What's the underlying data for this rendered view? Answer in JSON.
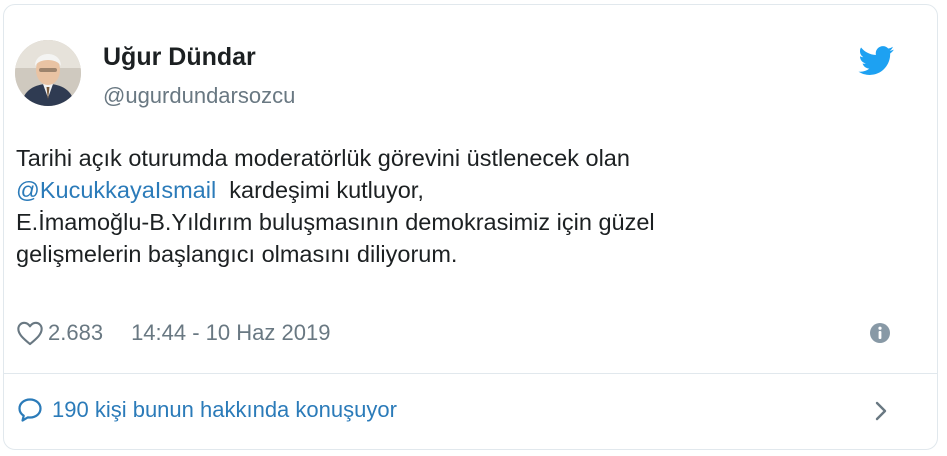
{
  "author": {
    "name": "Uğur Dündar",
    "handle": "@ugurdundarsozcu"
  },
  "tweet": {
    "text_line1": "Tarihi açık oturumda moderatörlük görevini üstlenecek olan",
    "mention": "@KucukkayaIsmail",
    "text_line2_rest": "  kardeşimi kutluyor,",
    "text_line3": "E.İmamoğlu-B.Yıldırım buluşmasının demokrasimiz için güzel",
    "text_line4": "gelişmelerin başlangıcı olmasını diliyorum."
  },
  "meta": {
    "likes": "2.683",
    "timestamp": "14:44 - 10 Haz 2019"
  },
  "footer": {
    "conversation_label": "190 kişi bunun hakkında konuşuyor"
  },
  "icons": {
    "brand": "twitter-bird-icon",
    "like": "heart-icon",
    "info": "info-icon",
    "reply": "speech-bubble-icon",
    "chevron": "chevron-right-icon"
  },
  "colors": {
    "twitter_blue": "#1da1f2",
    "link": "#2b7bb9",
    "secondary_text": "#697882",
    "primary_text": "#1c2022",
    "border": "#e1e8ed"
  }
}
